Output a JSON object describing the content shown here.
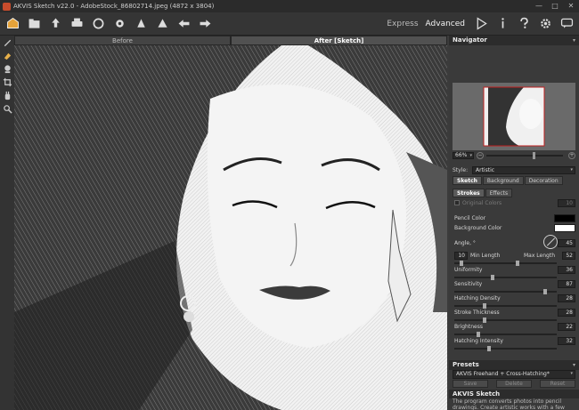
{
  "window": {
    "title": "AKVIS Sketch v22.0 - AdobeStock_86802714.jpeg (4872 x 3804)",
    "controls": [
      "—",
      "□",
      "✕"
    ]
  },
  "toolbar": {
    "icons": [
      "home-icon",
      "open-icon",
      "save-icon",
      "print-icon",
      "share-icon",
      "run-icon",
      "batch-icon",
      "apply-icon",
      "undo-icon",
      "redo-icon"
    ],
    "modes": [
      "Express",
      "Advanced"
    ],
    "right_icons": [
      "play-icon",
      "info-icon",
      "help-icon",
      "settings-icon",
      "chat-icon"
    ]
  },
  "tools": [
    "brush-icon",
    "eraser-icon",
    "stamp-icon",
    "crop-icon",
    "hand-icon",
    "zoom-icon"
  ],
  "image_tabs": {
    "before": "Before",
    "after": "After [Sketch]"
  },
  "navigator": {
    "title": "Navigator",
    "zoom": "66%",
    "minus": "−",
    "plus": "+"
  },
  "style": {
    "label": "Style:",
    "value": "Artistic"
  },
  "main_tabs": [
    "Sketch",
    "Background",
    "Decoration"
  ],
  "sub_tabs": [
    "Strokes",
    "Effects"
  ],
  "params": {
    "original_colors": {
      "label": "Original Colors",
      "value": "10"
    },
    "pencil_color": "Pencil Color",
    "background_color": "Background Color",
    "angle": {
      "label": "Angle, °",
      "value": "45"
    },
    "min_length": {
      "label": "Min Length",
      "value": "10"
    },
    "max_length": {
      "label": "Max Length",
      "value": "52"
    },
    "uniformity": {
      "label": "Uniformity",
      "value": "36"
    },
    "sensitivity": {
      "label": "Sensitivity",
      "value": "87"
    },
    "hatching_density": {
      "label": "Hatching Density",
      "value": "28"
    },
    "stroke_thickness": {
      "label": "Stroke Thickness",
      "value": "28"
    },
    "brightness": {
      "label": "Brightness",
      "value": "22"
    },
    "hatching_intensity": {
      "label": "Hatching Intensity",
      "value": "32"
    }
  },
  "presets": {
    "title": "Presets",
    "value": "AKVIS Freehand + Cross-Hatching*",
    "save": "Save",
    "delete": "Delete",
    "reset": "Reset"
  },
  "about": {
    "title": "AKVIS Sketch",
    "text": "The program converts photos into pencil drawings. Create artistic works with a few mouse clicks! You can first process your photo at the default settings, using the AKVIS presets, then adjust the parameters as you like."
  },
  "colors": {
    "pencil": "#000000",
    "background": "#ffffff"
  }
}
